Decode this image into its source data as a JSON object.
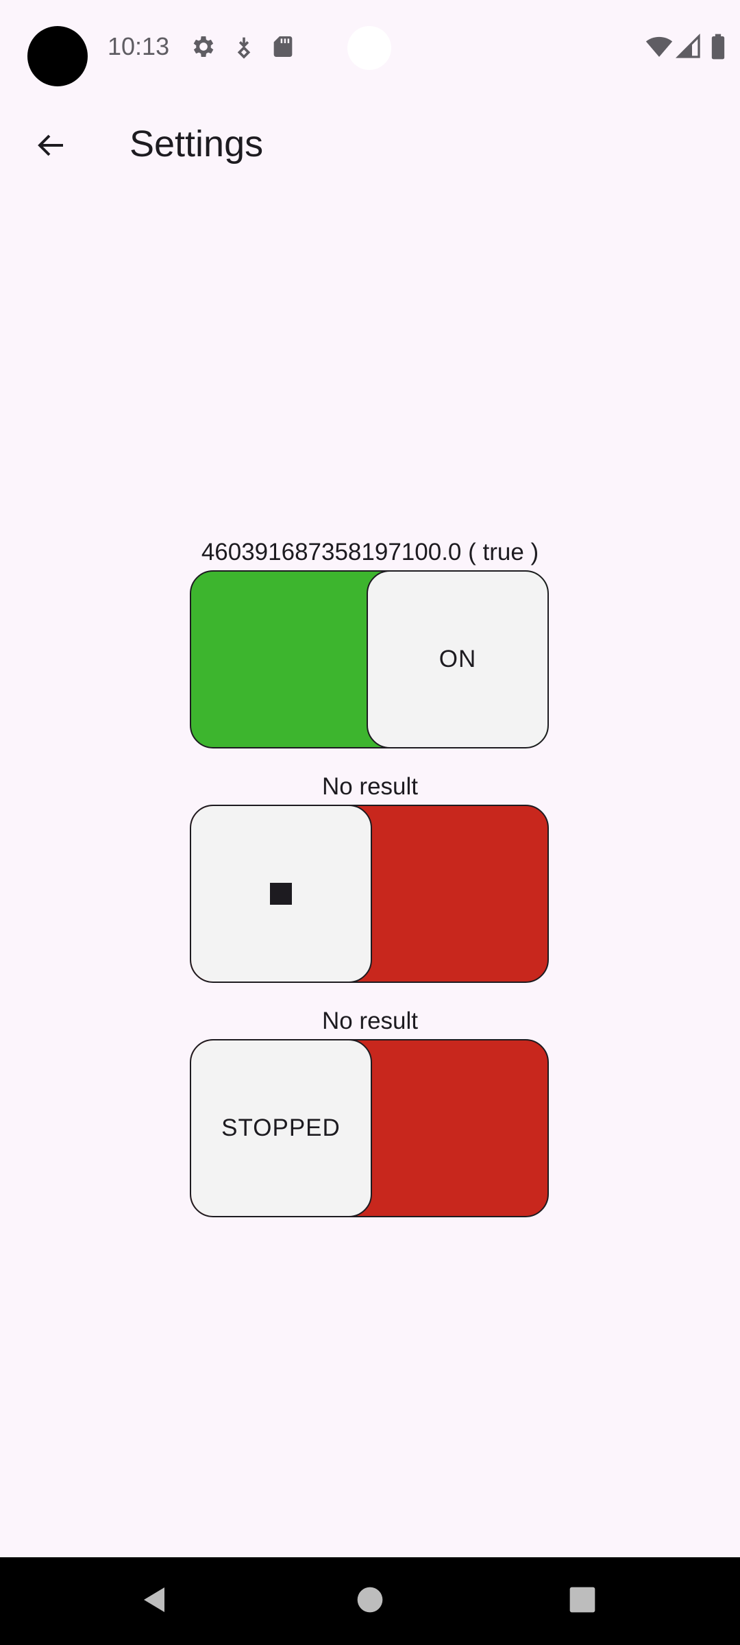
{
  "status_bar": {
    "time": "10:13",
    "left_icons": [
      "gear-icon",
      "download-icon",
      "sd-card-icon"
    ],
    "right_icons": [
      "wifi-icon",
      "cell-signal-icon",
      "battery-icon"
    ]
  },
  "app_bar": {
    "title": "Settings",
    "back_icon": "arrow-back-icon"
  },
  "switches": [
    {
      "caption": "460391687358197100.0 ( true )",
      "thumb_label": "ON",
      "thumb_position": "right",
      "track_color": "#3db52e"
    },
    {
      "caption": "No result",
      "thumb_label": "",
      "thumb_icon": "stop-icon",
      "thumb_position": "left",
      "track_color": "#c8271d"
    },
    {
      "caption": "No result",
      "thumb_label": "STOPPED",
      "thumb_position": "left",
      "track_color": "#c8271d"
    }
  ],
  "nav_bar": {
    "icons": [
      "back-triangle-icon",
      "home-circle-icon",
      "recents-square-icon"
    ]
  },
  "colors": {
    "background": "#fcf5fc",
    "on_green": "#3db52e",
    "off_red": "#c8271d",
    "thumb": "#f3f3f3"
  }
}
